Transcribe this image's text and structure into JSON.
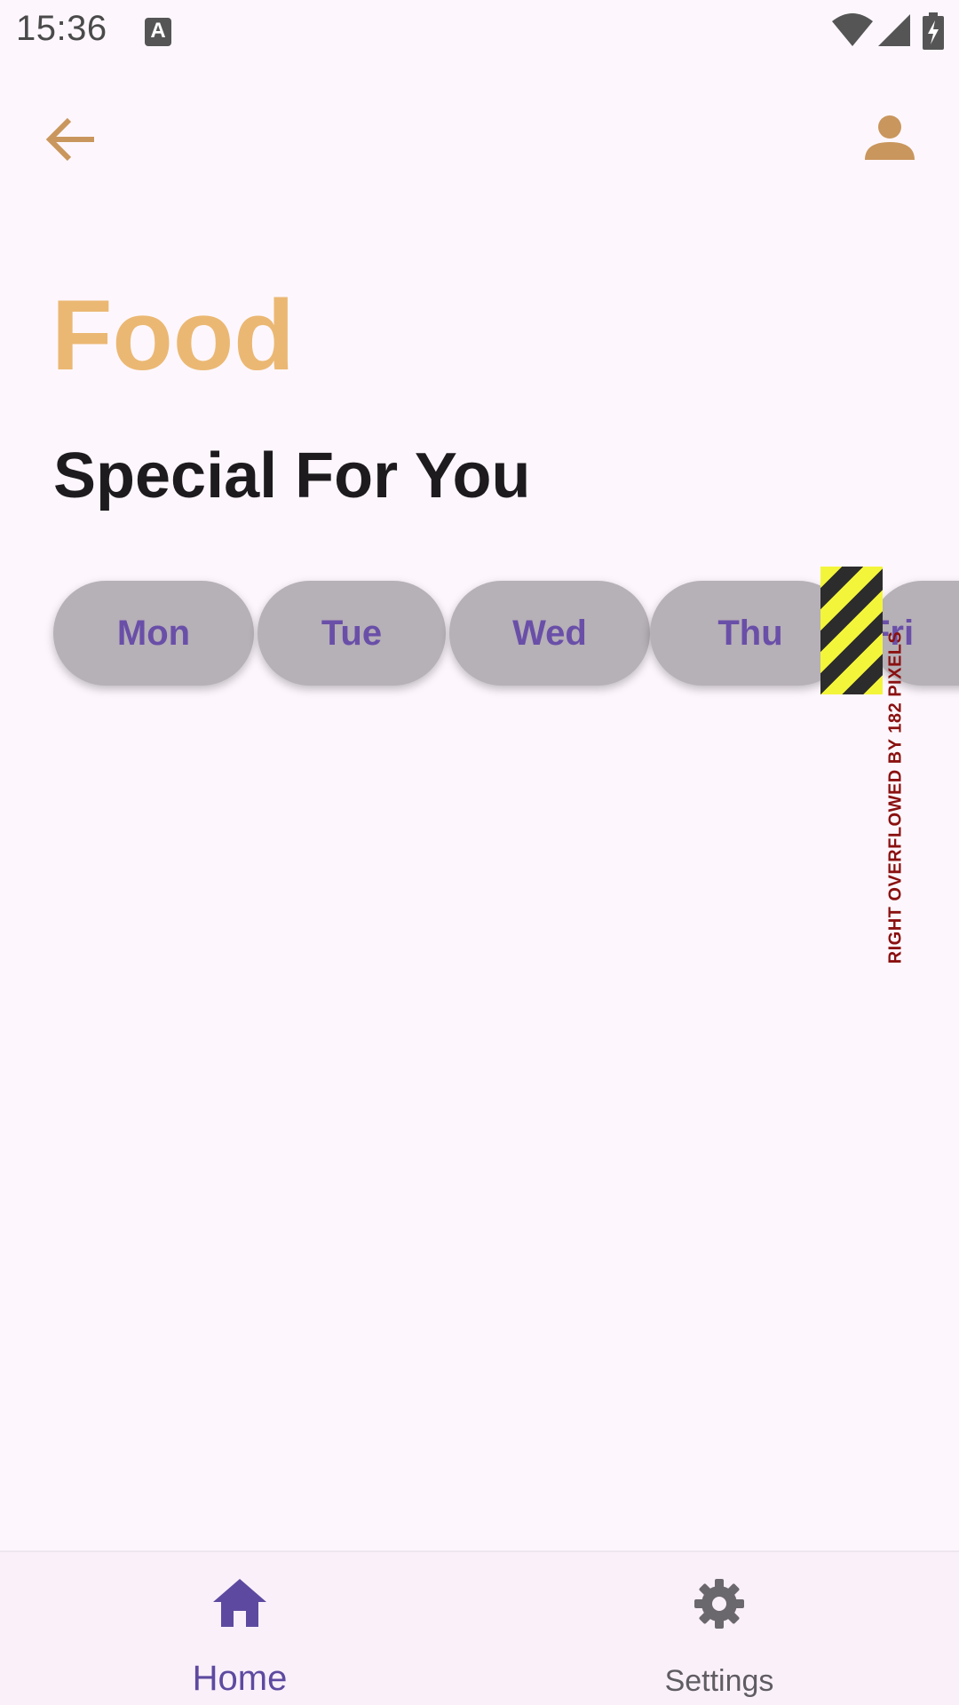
{
  "status_bar": {
    "time": "15:36",
    "notification_icon": "a-icon",
    "icons": [
      "wifi-icon",
      "signal-icon",
      "battery-charging-icon"
    ]
  },
  "app_bar": {
    "back_icon": "arrow-back-icon",
    "profile_icon": "person-icon",
    "accent_color": "#c9965d"
  },
  "header": {
    "title": "Food",
    "title_color": "#ebb873",
    "subtitle": "Special For You"
  },
  "days": {
    "items": [
      "Mon",
      "Tue",
      "Wed",
      "Thu",
      "Fri"
    ],
    "chip_color": "#b6b0b7",
    "label_color": "#6a4fa8"
  },
  "overflow_warning": {
    "text": "RIGHT OVERFLOWED BY 182 PIXELS"
  },
  "bottom_nav": {
    "items": [
      {
        "label": "Home",
        "icon": "home-icon",
        "selected": true
      },
      {
        "label": "Settings",
        "icon": "gear-icon",
        "selected": false
      }
    ],
    "active_color": "#5d4aa0",
    "inactive_color": "#5f5c62"
  }
}
